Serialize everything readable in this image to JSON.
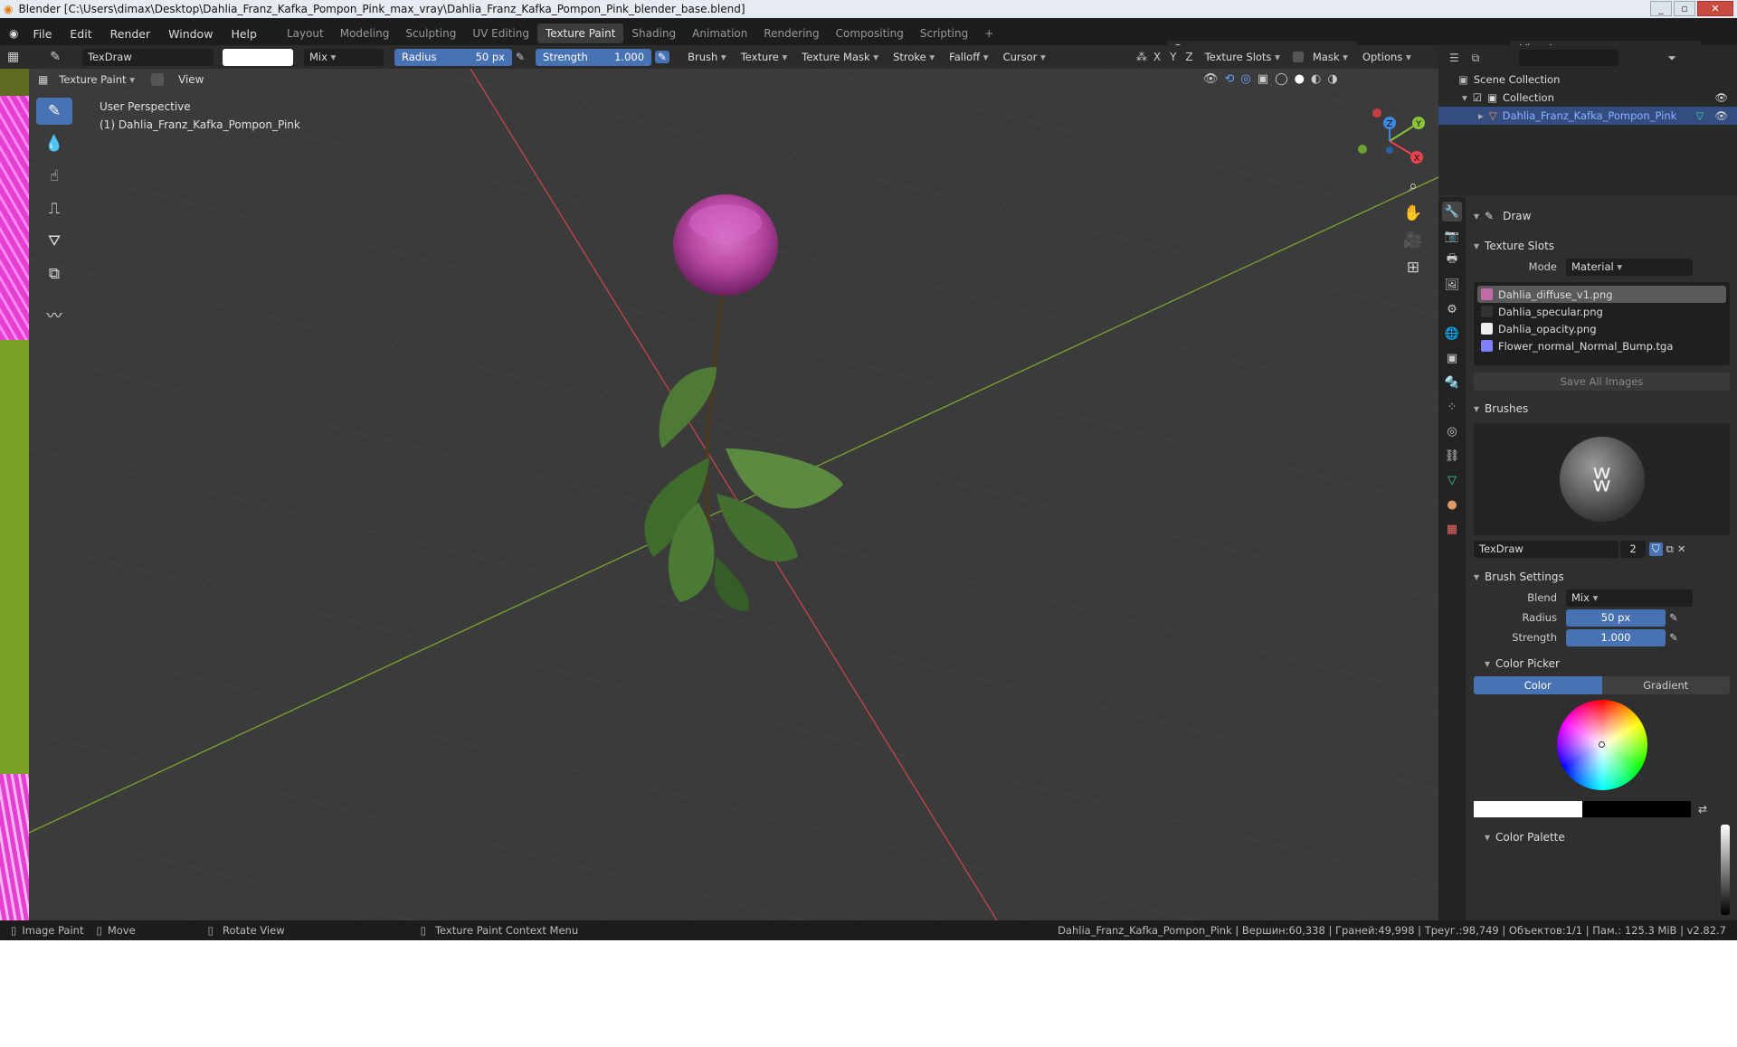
{
  "window": {
    "title": "Blender [C:\\Users\\dimax\\Desktop\\Dahlia_Franz_Kafka_Pompon_Pink_max_vray\\Dahlia_Franz_Kafka_Pompon_Pink_blender_base.blend]",
    "minimize": "_",
    "maximize": "▫",
    "close": "✕"
  },
  "menu": {
    "items": [
      "File",
      "Edit",
      "Render",
      "Window",
      "Help"
    ]
  },
  "workspaces": {
    "tabs": [
      "Layout",
      "Modeling",
      "Sculpting",
      "UV Editing",
      "Texture Paint",
      "Shading",
      "Animation",
      "Rendering",
      "Compositing",
      "Scripting"
    ],
    "active": "Texture Paint",
    "add": "+"
  },
  "scene": {
    "name": "Scene",
    "view_layer": "View Layer"
  },
  "tool_header": {
    "brush_name": "TexDraw",
    "blend": "Mix",
    "radius_label": "Radius",
    "radius_value": "50 px",
    "strength_label": "Strength",
    "strength_value": "1.000",
    "menus": [
      "Brush",
      "Texture",
      "Texture Mask",
      "Stroke",
      "Falloff",
      "Cursor"
    ],
    "axes": [
      "X",
      "Y",
      "Z"
    ],
    "texture_slots": "Texture Slots",
    "mask": "Mask",
    "options": "Options"
  },
  "viewport_header": {
    "mode": "Texture Paint",
    "view": "View"
  },
  "viewport": {
    "perspective": "User Perspective",
    "object": "(1) Dahlia_Franz_Kafka_Pompon_Pink",
    "gizmo": {
      "x": "X",
      "y": "Y",
      "z": "Z",
      "x_color": "#e8434f",
      "y_color": "#8bc43b",
      "z_color": "#3d89e0"
    },
    "axis_colors": {
      "x_line": "#c4444d",
      "y_line": "#7ea331"
    }
  },
  "outliner": {
    "scene_collection": "Scene Collection",
    "collection": "Collection",
    "object": "Dahlia_Franz_Kafka_Pompon_Pink"
  },
  "properties": {
    "tool_name": "Draw",
    "texture_slots": {
      "title": "Texture Slots",
      "mode_label": "Mode",
      "mode_value": "Material",
      "slots": [
        {
          "name": "Dahlia_diffuse_v1.png",
          "color": "#c06aa8"
        },
        {
          "name": "Dahlia_specular.png",
          "color": "#333333"
        },
        {
          "name": "Dahlia_opacity.png",
          "color": "#eeeeee"
        },
        {
          "name": "Flower_normal_Normal_Bump.tga",
          "color": "#8080ff"
        }
      ],
      "save_all": "Save All Images"
    },
    "brushes": {
      "title": "Brushes",
      "name": "TexDraw",
      "users": "2"
    },
    "brush_settings": {
      "title": "Brush Settings",
      "blend_label": "Blend",
      "blend_value": "Mix",
      "radius_label": "Radius",
      "radius_value": "50 px",
      "strength_label": "Strength",
      "strength_value": "1.000"
    },
    "color_picker": {
      "title": "Color Picker",
      "tab_color": "Color",
      "tab_gradient": "Gradient"
    },
    "color_palette": {
      "title": "Color Palette"
    }
  },
  "statusbar": {
    "left": [
      "Image Paint",
      "Move",
      "Rotate View",
      "Texture Paint Context Menu"
    ],
    "stats": "Dahlia_Franz_Kafka_Pompon_Pink | Вершин:60,338 | Граней:49,998 | Треуг.:98,749 | Объектов:1/1 | Пам.: 125.3 MiB | v2.82.7"
  },
  "colors": {
    "accent": "#4772b3",
    "selection": "#334d80",
    "flower": "#b3449e"
  }
}
